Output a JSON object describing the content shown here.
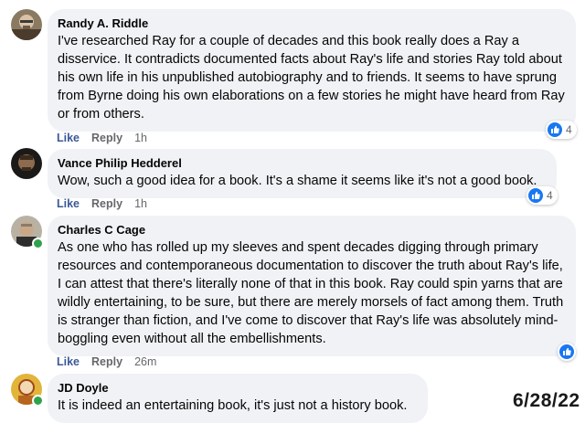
{
  "comments": [
    {
      "author": "Randy A. Riddle",
      "text": "I've researched Ray for a couple of decades and this book really does a Ray a disservice. It contradicts documented facts about Ray's life and stories Ray told about his own life in his unpublished autobiography and to friends. It seems to have sprung from Byrne doing his own elaborations on a few stories he might have heard from Ray or from others.",
      "like_label": "Like",
      "reply_label": "Reply",
      "time": "1h",
      "reaction_count": "4",
      "reaction_icon": "thumbs-up-icon"
    },
    {
      "author": "Vance Philip Hedderel",
      "text": "Wow, such a good idea for a book. It's a shame it seems like it's not a good book.",
      "like_label": "Like",
      "reply_label": "Reply",
      "time": "1h",
      "reaction_count": "4",
      "reaction_icon": "thumbs-up-icon"
    },
    {
      "author": "Charles C Cage",
      "text": "As one who has rolled up my sleeves and spent decades digging through primary resources and contemporaneous documentation to discover the truth about Ray's life, I can attest that there's literally none of that in this book. Ray could spin yarns that are wildly entertaining, to be sure, but there are merely morsels of fact among them. Truth is stranger than fiction, and I've come to discover that Ray's life was absolutely mind-boggling even without all the embellishments.",
      "like_label": "Like",
      "reply_label": "Reply",
      "time": "26m",
      "reaction_icon": "thumbs-up-icon",
      "online": true
    },
    {
      "author": "JD Doyle",
      "text": "It is indeed an entertaining book, it's just not a history book.",
      "online": true
    }
  ],
  "date_stamp": "6/28/22",
  "colors": {
    "bubble": "#f0f2f5",
    "like_blue": "#1877f2",
    "link_blue": "#3b5998",
    "muted": "#65676b",
    "online_green": "#31a24c"
  }
}
